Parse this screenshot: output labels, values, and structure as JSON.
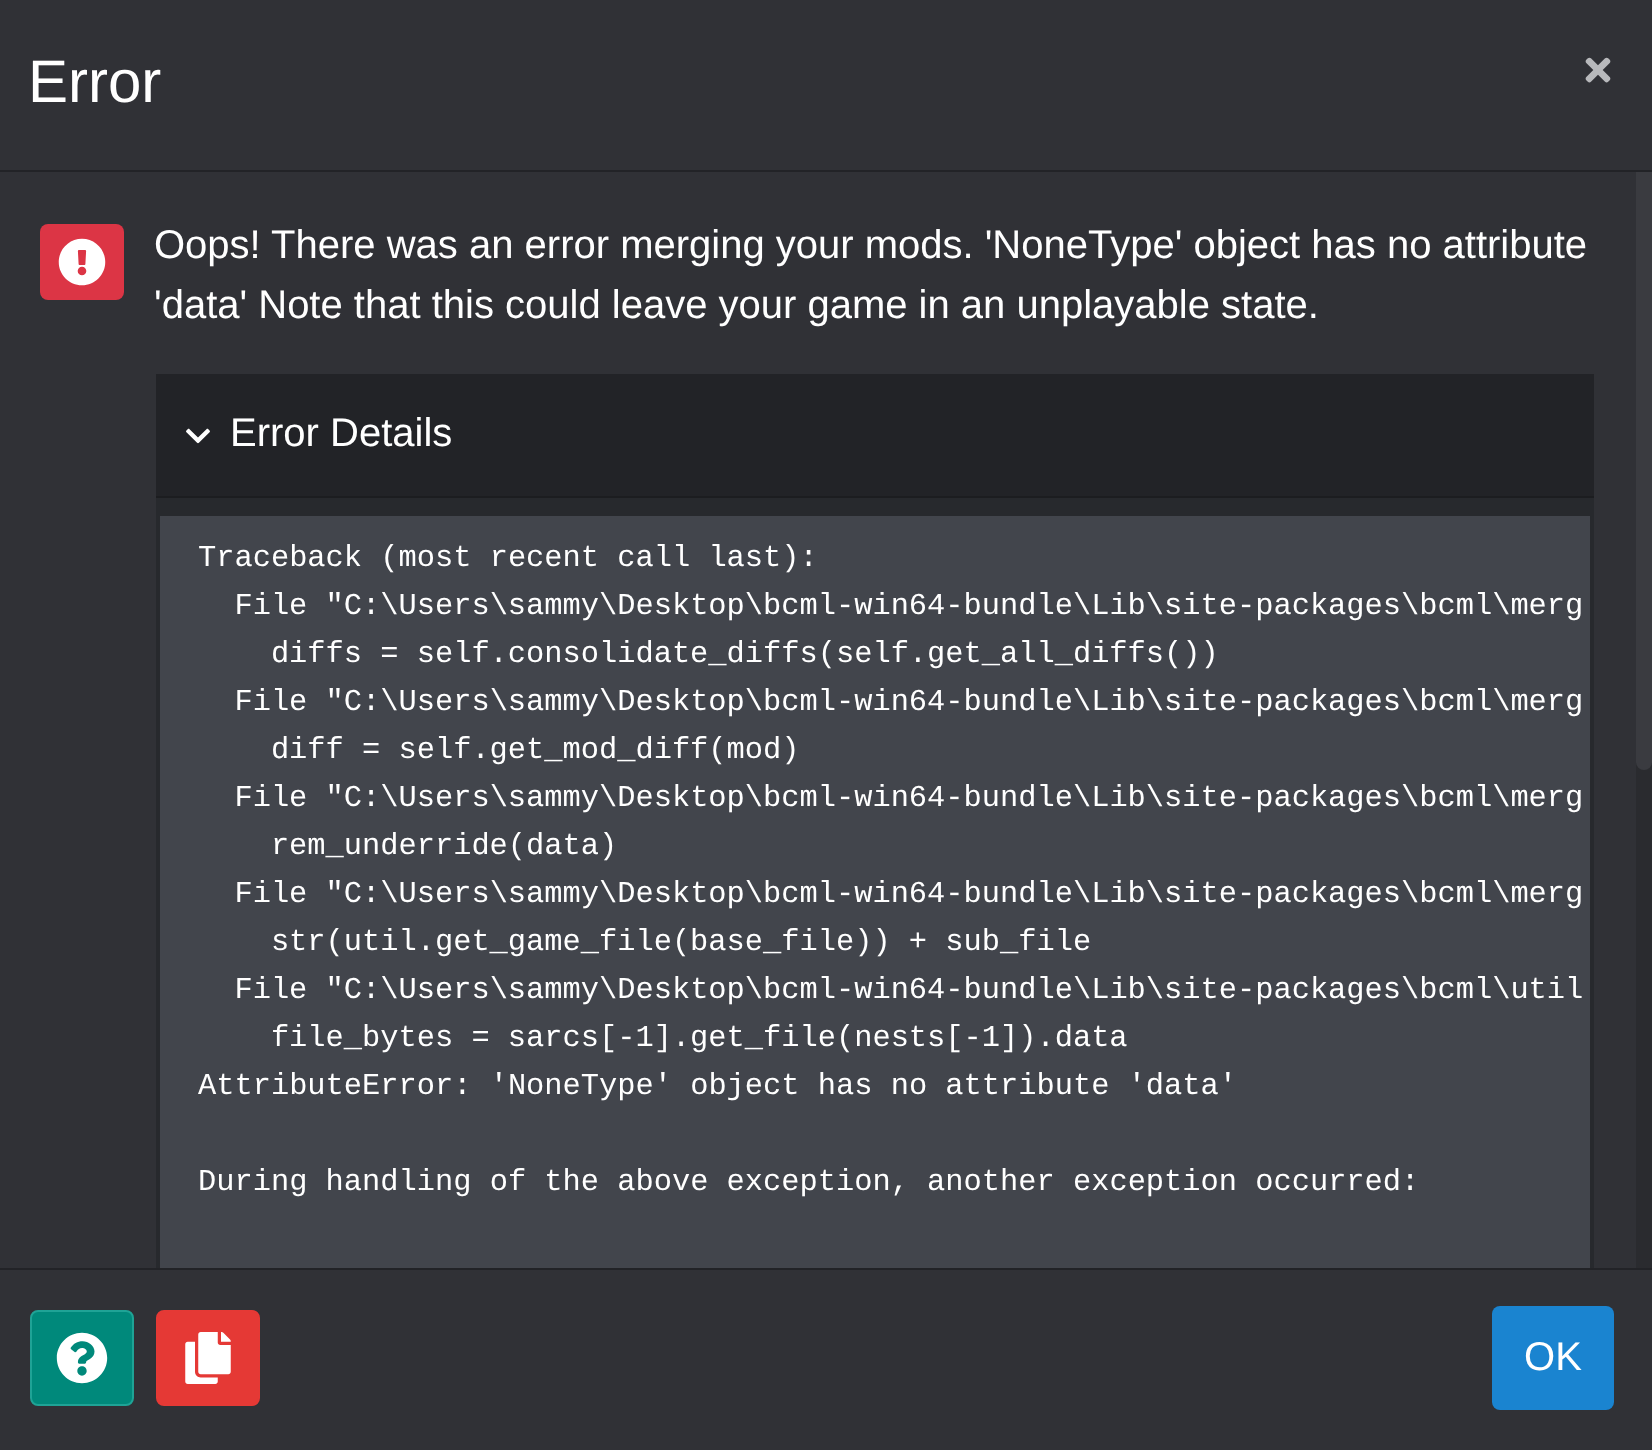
{
  "window": {
    "title": "Error"
  },
  "message": {
    "text": "Oops! There was an error merging your mods. 'NoneType' object has no attribute 'data' Note that this could leave your game in an unplayable state."
  },
  "details": {
    "title": "Error Details",
    "expanded": true,
    "traceback": [
      {
        "lines": [
          {
            "text": "Traceback (most recent call last):",
            "children": [
              {
                "text": "File \"C:\\Users\\sammy\\Desktop\\bcml-win64-bundle\\Lib\\site-packages\\bcml\\merg",
                "children": [
                  {
                    "text": "diffs = self.consolidate_diffs(self.get_all_diffs())"
                  }
                ]
              },
              {
                "text": "File \"C:\\Users\\sammy\\Desktop\\bcml-win64-bundle\\Lib\\site-packages\\bcml\\merg",
                "children": [
                  {
                    "text": "diff = self.get_mod_diff(mod)"
                  }
                ]
              },
              {
                "text": "File \"C:\\Users\\sammy\\Desktop\\bcml-win64-bundle\\Lib\\site-packages\\bcml\\merg",
                "children": [
                  {
                    "text": "rem_underride(data)"
                  }
                ]
              },
              {
                "text": "File \"C:\\Users\\sammy\\Desktop\\bcml-win64-bundle\\Lib\\site-packages\\bcml\\merg",
                "children": [
                  {
                    "text": "str(util.get_game_file(base_file)) + sub_file"
                  }
                ]
              },
              {
                "text": "File \"C:\\Users\\sammy\\Desktop\\bcml-win64-bundle\\Lib\\site-packages\\bcml\\util",
                "children": [
                  {
                    "text": "file_bytes = sarcs[-1].get_file(nests[-1]).data"
                  }
                ]
              }
            ]
          },
          {
            "text": "AttributeError: 'NoneType' object has no attribute 'data'"
          }
        ]
      },
      {
        "lines": [
          {
            "text": "During handling of the above exception, another exception occurred:"
          }
        ]
      }
    ]
  },
  "footer": {
    "buttons": [
      {
        "kind": "help"
      },
      {
        "kind": "copy"
      },
      {
        "kind": "confirm",
        "label": "OK"
      }
    ]
  }
}
